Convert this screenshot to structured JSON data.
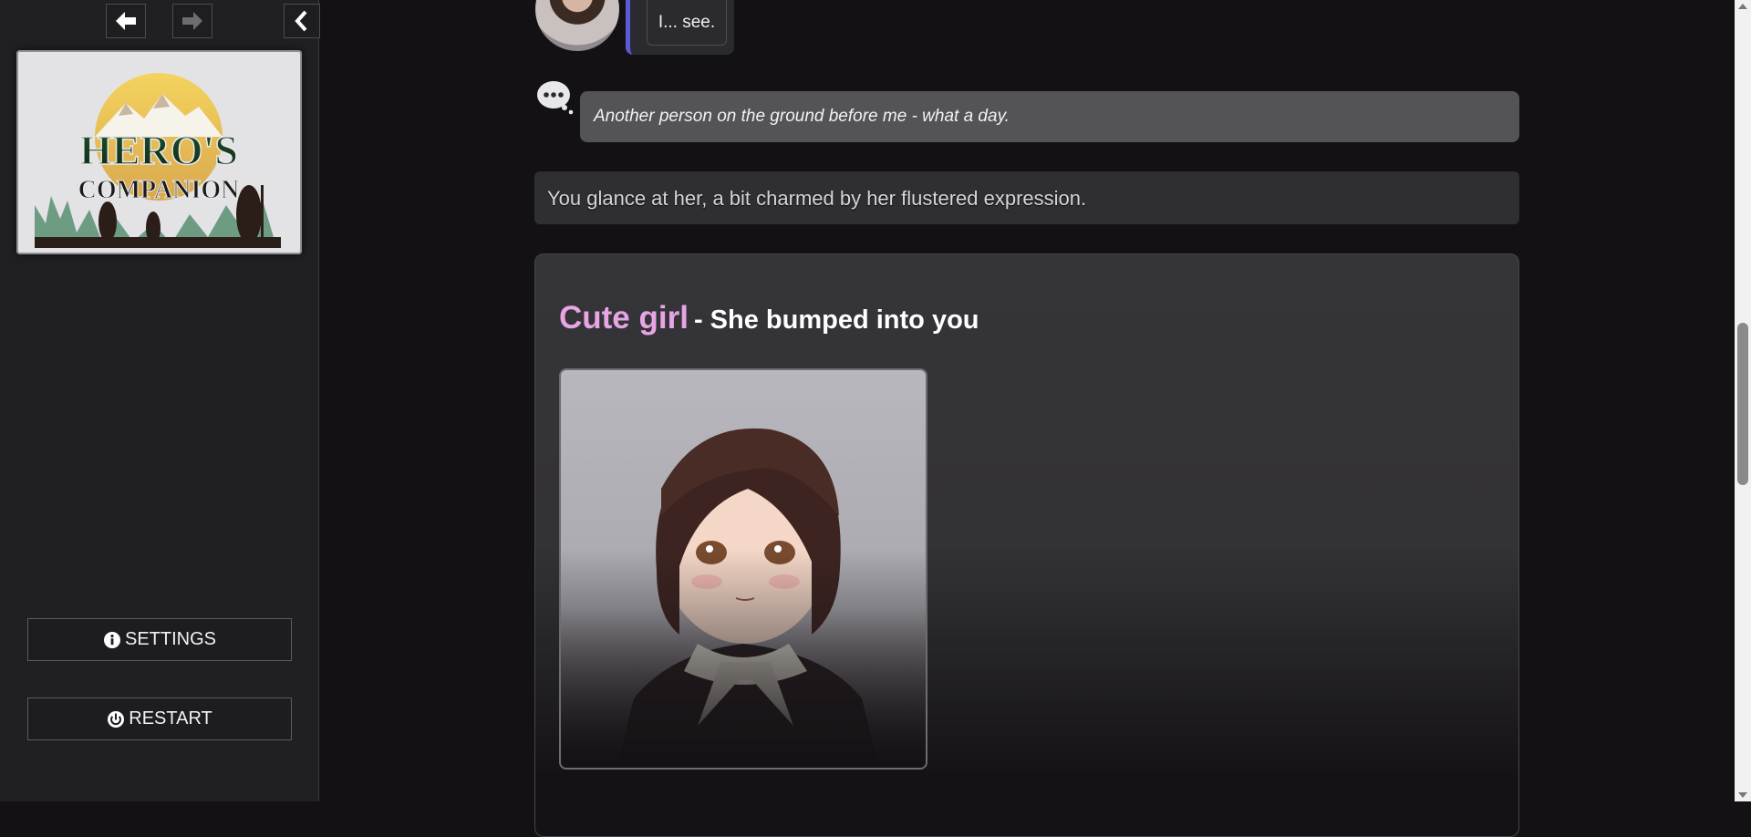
{
  "sidebar": {
    "back_icon": "arrow-left-icon",
    "forward_icon": "arrow-right-icon",
    "collapse_icon": "chevron-left-icon",
    "logo": {
      "line1": "HERO'S",
      "line2": "COMPANION"
    },
    "settings_label": "SETTINGS",
    "settings_icon": "info-icon",
    "restart_label": "RESTART",
    "restart_icon": "power-icon"
  },
  "messages": {
    "dialogue_text": "I... see.",
    "thought_text": "Another person on the ground before me - what a day.",
    "narration_text": "You glance at her, a bit charmed by her flustered expression."
  },
  "character_card": {
    "name": "Cute girl",
    "subtitle": "- She bumped into you",
    "name_color": "#e7a5e3"
  },
  "colors": {
    "accent_bar": "#5b5bd6",
    "background": "#131114",
    "sidebar_bg": "#202022"
  }
}
